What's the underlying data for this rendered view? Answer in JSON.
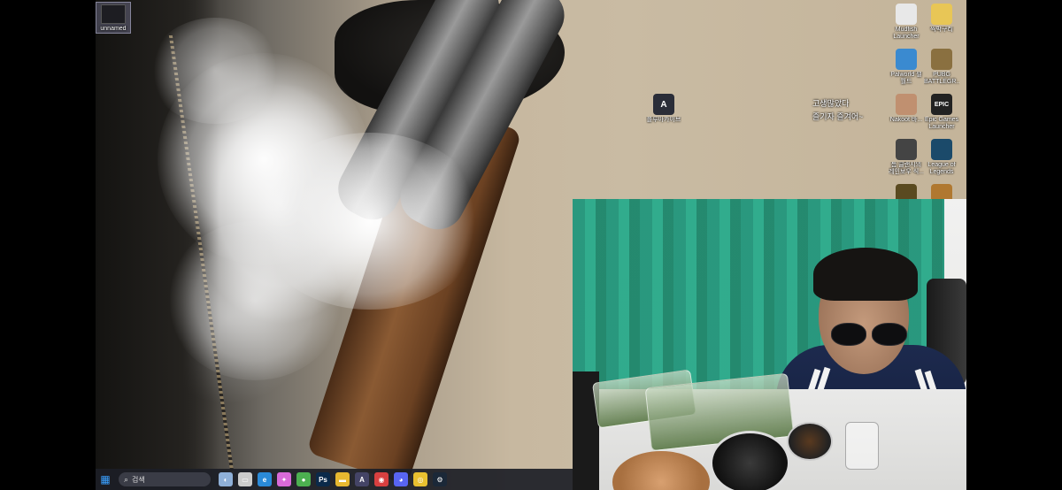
{
  "desktop": {
    "corner_icon": {
      "label": "unnamed"
    },
    "icons": [
      {
        "id": "mudfish",
        "label": "Mudfish Launcher",
        "icon": "mudfish-icon",
        "color": "#e8e8e8"
      },
      {
        "id": "jjikbak",
        "label": "찍박구리",
        "icon": "folder-icon",
        "color": "#e8c656"
      },
      {
        "id": "palworld",
        "label": "Palworld 펠 월드",
        "icon": "palworld-icon",
        "color": "#3a8ad0"
      },
      {
        "id": "pubg",
        "label": "PUBG BATTLEGR...",
        "icon": "pubg-icon",
        "color": "#8a7040"
      },
      {
        "id": "user",
        "label": "Nakoot 바...",
        "icon": "person-icon",
        "color": "#c09070"
      },
      {
        "id": "epic",
        "label": "Epic Games Launcher",
        "icon": "epic-games-icon",
        "color": "#222222",
        "glyph": "EPIC"
      },
      {
        "id": "rainbow",
        "label": "톰 클랜시의 레인보우 식...",
        "icon": "rainbow-six-icon",
        "color": "#444444"
      },
      {
        "id": "lol",
        "label": "League of Legends",
        "icon": "league-icon",
        "color": "#1b4a6a"
      },
      {
        "id": "game9",
        "label": "",
        "icon": "game-icon",
        "color": "#5a4a20"
      },
      {
        "id": "game10",
        "label": "",
        "icon": "game-icon",
        "color": "#b07830"
      }
    ],
    "middle_icon": {
      "label": "블루아카이브",
      "icon": "blue-archive-icon",
      "glyph": "A"
    },
    "note_lines": [
      "고생많았다",
      "즐기자 즐겨어~"
    ]
  },
  "taskbar": {
    "search_placeholder": "검색",
    "items": [
      {
        "name": "start-icon",
        "glyph": "▦",
        "color": "#3aa0ff"
      },
      {
        "name": "widget-icon",
        "glyph": "◐",
        "color": "#8fb0d8"
      },
      {
        "name": "task-view-icon",
        "glyph": "▭",
        "color": "#cccccc"
      },
      {
        "name": "edge-icon",
        "glyph": "e",
        "color": "#2a8ad8"
      },
      {
        "name": "copilot-icon",
        "glyph": "✦",
        "color": "#d86ad8"
      },
      {
        "name": "chrome-alt-icon",
        "glyph": "●",
        "color": "#4cb050"
      },
      {
        "name": "photoshop-icon",
        "glyph": "Ps",
        "color": "#0b2a4a"
      },
      {
        "name": "file-explorer-icon",
        "glyph": "▬",
        "color": "#e8b830"
      },
      {
        "name": "blue-archive-icon",
        "glyph": "A",
        "color": "#444466"
      },
      {
        "name": "store-icon",
        "glyph": "◉",
        "color": "#d84040"
      },
      {
        "name": "discord-icon",
        "glyph": "◕",
        "color": "#5865f2"
      },
      {
        "name": "chrome-icon",
        "glyph": "◎",
        "color": "#e8c030"
      },
      {
        "name": "steam-icon",
        "glyph": "⚙",
        "color": "#1b2838"
      }
    ]
  },
  "webcam": {
    "present": true
  }
}
